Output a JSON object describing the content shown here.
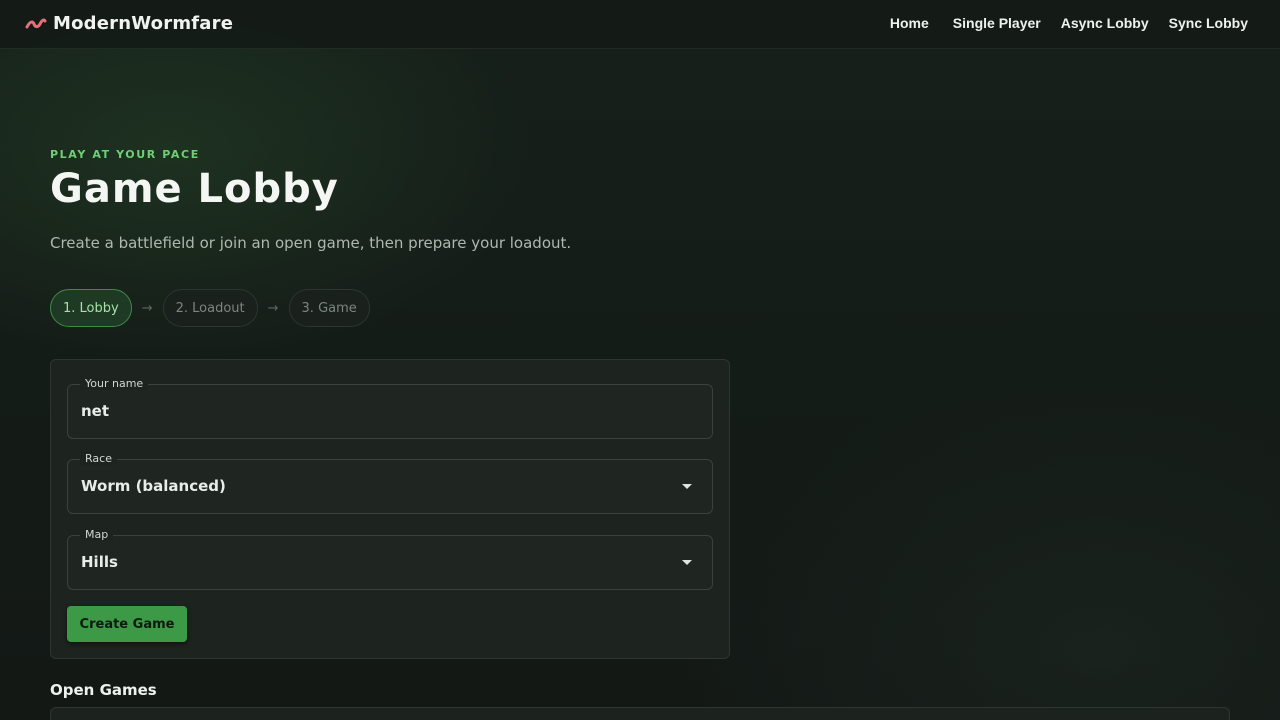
{
  "header": {
    "brand": "ModernWormfare",
    "brand_icon": "worm-icon",
    "nav": [
      "Home",
      "Single Player",
      "Async Lobby",
      "Sync Lobby"
    ]
  },
  "hero": {
    "kicker": "PLAY AT YOUR PACE",
    "title": "Game Lobby",
    "subtitle": "Create a battlefield or join an open game, then prepare your loadout."
  },
  "steps": [
    {
      "label": "1. Lobby",
      "active": true
    },
    {
      "label": "2. Loadout",
      "active": false
    },
    {
      "label": "3. Game",
      "active": false
    }
  ],
  "step_separator": "→",
  "form": {
    "name_label": "Your name",
    "name_value": "net",
    "race_label": "Race",
    "race_value": "Worm (balanced)",
    "map_label": "Map",
    "map_value": "Hills",
    "create_button": "Create Game"
  },
  "open_games": {
    "title": "Open Games"
  },
  "colors": {
    "accent": "#3c9a47",
    "kicker": "#6fcf74",
    "brand_icon": "#e8707a"
  }
}
